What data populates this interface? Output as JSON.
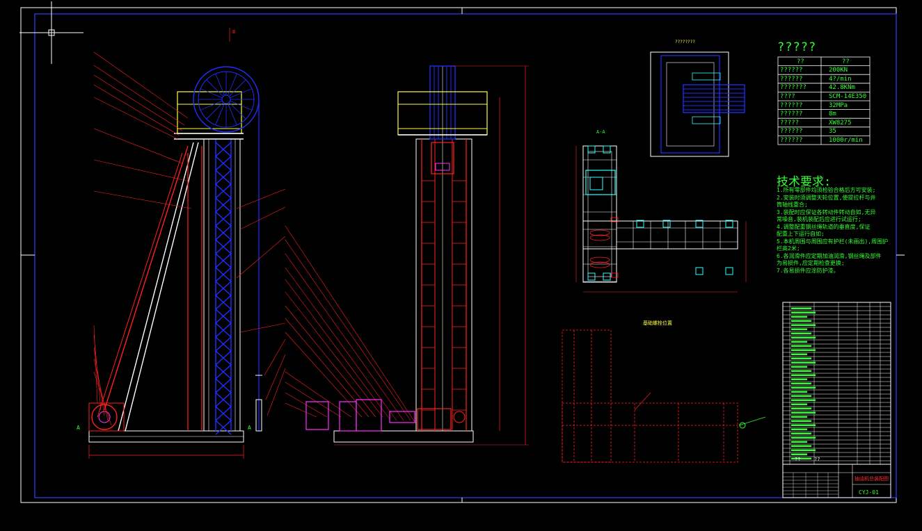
{
  "drawing": {
    "section_label": "A-A",
    "view_label_b": "B",
    "top_view_label": "????????",
    "foundation_label": "基础螺栓位置"
  },
  "param_table": {
    "title": "?????",
    "header": [
      "??",
      "??"
    ],
    "rows": [
      [
        "??????",
        "200KN"
      ],
      [
        "??????",
        "4?/min"
      ],
      [
        "???????",
        "42.8KNm"
      ],
      [
        "????",
        "SCM-14E350"
      ],
      [
        "??????",
        "32MPa"
      ],
      [
        "??????",
        "8m"
      ],
      [
        "?????",
        "XW8275"
      ],
      [
        "??????",
        "35"
      ],
      [
        "??????",
        "1000r/min"
      ]
    ]
  },
  "tech_requirements": {
    "title": "技术要求:",
    "items": [
      "1.所有零部件均须检验合格后方可安装;",
      "2.安装时须调整天轮位置,使提拉杆与井",
      "  筒轴线重合;",
      "3.装配时应保证各转动件转动自如,无异",
      "  常噪音,装机装配后应进行试运行;",
      "4.调整配重钢丝绳轨道的垂直度,保证",
      "  配重上下运行自如;",
      "5.本机周围与周围应有护栏(未画出),周围护",
      "  栏高2米;",
      "6.各润滑件应定期加油润滑,钢丝绳及部件",
      "  为易损件,应定期检查更换;",
      "7.各易损件应涂防护漆。"
    ]
  },
  "title_block": {
    "drawing_no": "CYJ-01",
    "project_name": "抽油机总装配图",
    "header_cols": [
      "??",
      "??"
    ]
  },
  "colors": {
    "background": "#000000",
    "frame": "#3040ff",
    "green": "#30ff30",
    "red": "#ff2020",
    "blue": "#2030ff",
    "yellow": "#ffff40",
    "white": "#ffffff",
    "magenta": "#ff30ff",
    "cyan": "#30ffff"
  }
}
